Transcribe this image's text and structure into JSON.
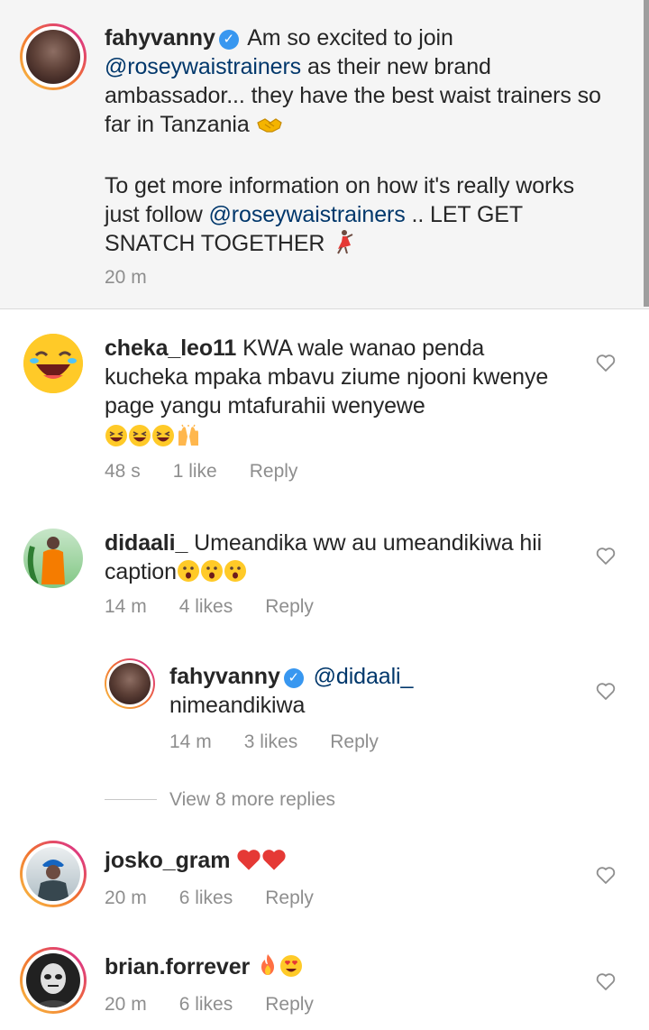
{
  "caption": {
    "username": "fahyvanny",
    "text_1": "Am so excited to join",
    "mention_1": "@roseywaistrainers",
    "text_2": "as their new brand ambassador... they have the best waist trainers so far in Tanzania",
    "text_3": "To get more information on how it's really works just follow",
    "mention_2": "@roseywaistrainers",
    "text_4": ".. LET GET SNATCH TOGETHER",
    "time": "20 m"
  },
  "comments": [
    {
      "username": "cheka_leo11",
      "text": "KWA wale wanao penda kucheka mpaka mbavu ziume njooni kwenye page yangu mtafurahii wenyewe",
      "time": "48 s",
      "likes": "1 like",
      "reply": "Reply"
    },
    {
      "username": "didaali_",
      "text": "Umeandika ww au umeandikiwa hii caption",
      "time": "14 m",
      "likes": "4 likes",
      "reply": "Reply"
    },
    {
      "username": "fahyvanny",
      "mention": "@didaali_",
      "text": "nimeandikiwa",
      "time": "14 m",
      "likes": "3 likes",
      "reply": "Reply"
    },
    {
      "username": "josko_gram",
      "time": "20 m",
      "likes": "6 likes",
      "reply": "Reply"
    },
    {
      "username": "brian.forrever",
      "time": "20 m",
      "likes": "6 likes",
      "reply": "Reply"
    }
  ],
  "view_more": "View 8 more replies",
  "icons": {
    "verified": "verified-badge-icon",
    "like": "heart-outline-icon"
  },
  "colors": {
    "mention": "#00376b",
    "verified": "#3897f0",
    "meta": "#8e8e8e"
  }
}
